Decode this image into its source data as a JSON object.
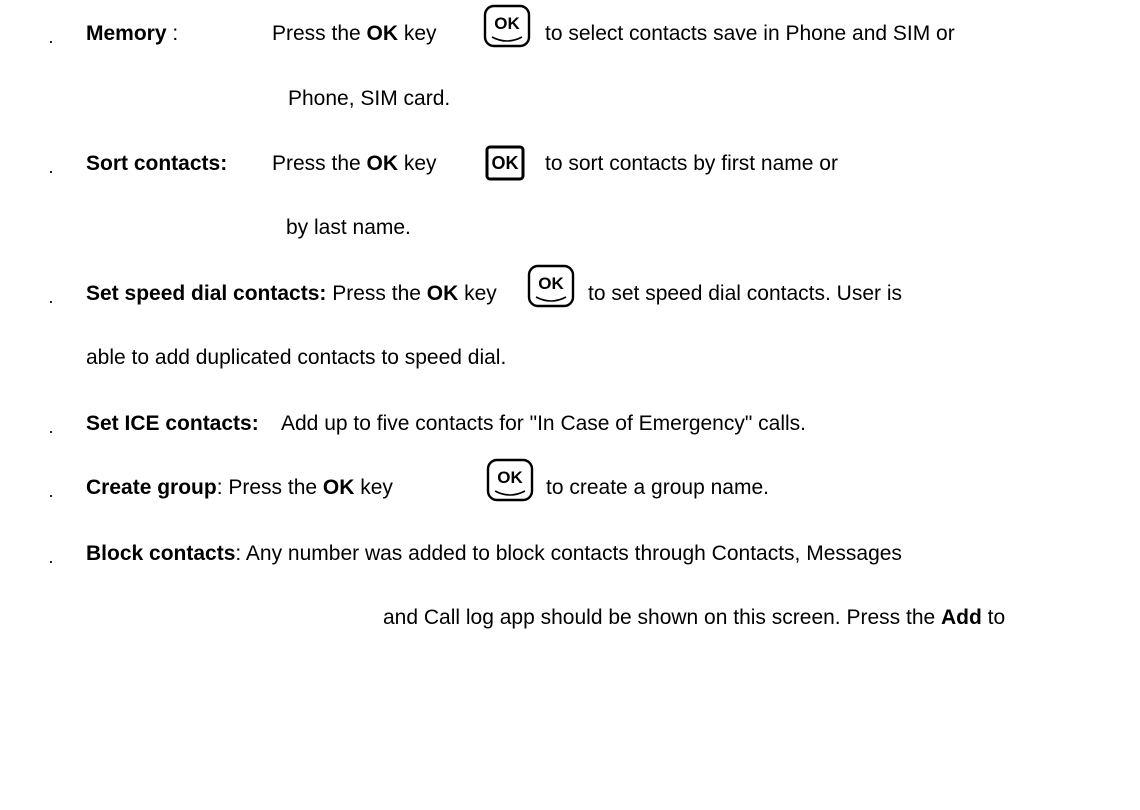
{
  "icon": "ok-key-icon",
  "items": [
    {
      "title": "Memory",
      "title_suffix": " :",
      "line1_before": "Press the ",
      "line1_key": "OK",
      "line1_key_after": " key",
      "line1_after_icon": "to select contacts save in Phone and SIM or",
      "line2": "Phone, SIM card."
    },
    {
      "title": "Sort contacts:",
      "line1_before": "Press the ",
      "line1_key": "OK",
      "line1_key_after": " key",
      "line1_after_icon": "to sort contacts by first name or",
      "line2": "by last name."
    },
    {
      "title": "Set speed dial contacts:",
      "line1_before": " Press the ",
      "line1_key": "OK",
      "line1_key_after": " key",
      "line1_after_icon": "to set speed dial contacts. User is",
      "line2": "able to add duplicated contacts to speed dial."
    },
    {
      "title": "Set ICE contacts:",
      "text": "Add up to five contacts for \"In Case of Emergency\" calls."
    },
    {
      "title": "Create group",
      "line1_before": ": Press the ",
      "line1_key": "OK",
      "line1_key_after": " key",
      "line1_after_icon": "to create a group name."
    },
    {
      "title": "Block contacts",
      "line1_after": ": Any number was added to block contacts through Contacts, Messages",
      "line2_before": "and Call log app should be shown on this screen. Press the ",
      "line2_key": "Add",
      "line2_after": " to"
    }
  ],
  "bullet_char": "·"
}
